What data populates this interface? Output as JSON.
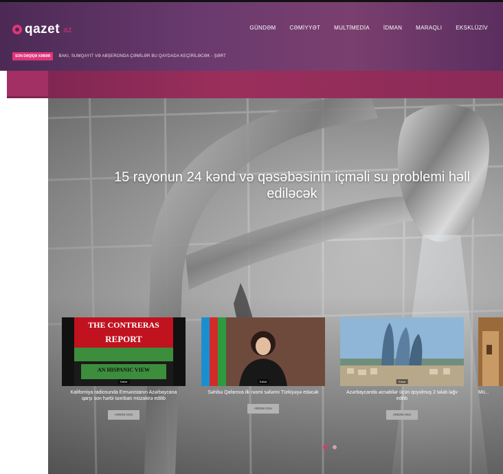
{
  "header": {
    "logo_text": "qazet",
    "logo_suffix": "az",
    "nav": [
      "GÜNDƏM",
      "CƏMİYYƏT",
      "MULTİMEDİA",
      "İDMAN",
      "MARAQLI",
      "EKSKLÜZİV"
    ],
    "ticker_badge": "SON DƏQİQƏ XƏBƏR",
    "ticker_text": "BAKI, SUMQAYIT VƏ ABŞERONDA ÇƏMİLƏR BU QAYDADA KEÇİRİLƏCƏK - ŞƏRT"
  },
  "hero": {
    "headline": "15 rayonun 24 kənd və qəsəbəsinin içməli su problemi həll ediləcək"
  },
  "cards": [
    {
      "image_title_1": "THE CONTRERAS",
      "image_title_2": "REPORT",
      "image_subtitle": "AN HISPANIC VIEW",
      "image_tag": "Xəbər",
      "caption": "Kaliforniya radiosunda Ermənistanın Azərbaycana qarşı son hərbi təxribatı müzakirə edilib",
      "button": "ARDINI OXU"
    },
    {
      "image_tag": "Xəbər",
      "caption": "Səhibə Qafarova ilk rəsmi səfərini Türkiyəyə edəcək",
      "button": "ARDINI OXU"
    },
    {
      "image_tag": "Xəbər",
      "caption": "Azərbaycanda əcnəbilər üçün qoyulmuş 2 tələb ləğv edilib",
      "button": "ARDINI OXU"
    },
    {
      "caption": "Mü..."
    }
  ],
  "colors": {
    "accent": "#e0357a",
    "header_bg": "#5a2e5f"
  }
}
